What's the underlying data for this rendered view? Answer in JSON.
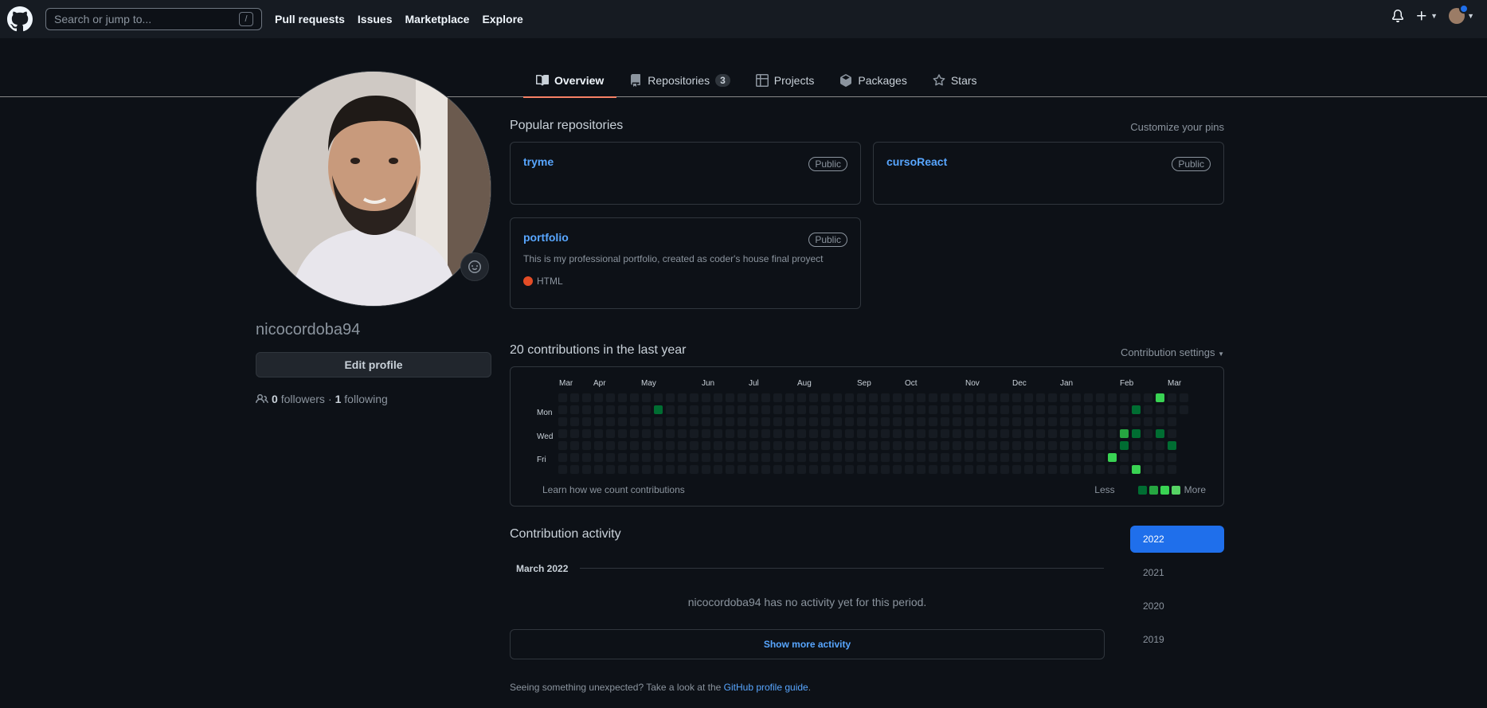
{
  "header": {
    "search_placeholder": "Search or jump to...",
    "search_shortcut": "/",
    "nav": [
      "Pull requests",
      "Issues",
      "Marketplace",
      "Explore"
    ]
  },
  "tabs": [
    {
      "label": "Overview",
      "icon": "book-icon"
    },
    {
      "label": "Repositories",
      "icon": "repo-icon",
      "count": "3"
    },
    {
      "label": "Projects",
      "icon": "table-icon"
    },
    {
      "label": "Packages",
      "icon": "package-icon"
    },
    {
      "label": "Stars",
      "icon": "star-icon"
    }
  ],
  "profile": {
    "username": "nicocordoba94",
    "edit_label": "Edit profile",
    "followers_count": "0",
    "followers_label": "followers",
    "separator": "·",
    "following_count": "1",
    "following_label": "following"
  },
  "popular": {
    "title": "Popular repositories",
    "customize": "Customize your pins",
    "repos": [
      {
        "name": "tryme",
        "visibility": "Public"
      },
      {
        "name": "cursoReact",
        "visibility": "Public"
      },
      {
        "name": "portfolio",
        "visibility": "Public",
        "description": "This is my professional portfolio, created as coder's house final proyect",
        "language": "HTML",
        "language_color": "#e34c26"
      }
    ]
  },
  "contributions": {
    "title": "20 contributions in the last year",
    "settings": "Contribution settings",
    "months": [
      "Mar",
      "Apr",
      "May",
      "Jun",
      "Jul",
      "Aug",
      "Sep",
      "Oct",
      "Nov",
      "Dec",
      "Jan",
      "Feb",
      "Mar"
    ],
    "days": [
      "Mon",
      "Wed",
      "Fri"
    ],
    "learn": "Learn how we count contributions",
    "less": "Less",
    "more": "More",
    "colors": [
      "#161b22",
      "#0e4429",
      "#006d32",
      "#26a641",
      "#39d353"
    ]
  },
  "activity": {
    "title": "Contribution activity",
    "month": "March 2022",
    "empty": "nicocordoba94 has no activity yet for this period.",
    "show_more": "Show more activity",
    "years": [
      "2022",
      "2021",
      "2020",
      "2019"
    ]
  },
  "footer": {
    "note": "Seeing something unexpected? Take a look at the",
    "link": "GitHub profile guide",
    "end": "."
  }
}
